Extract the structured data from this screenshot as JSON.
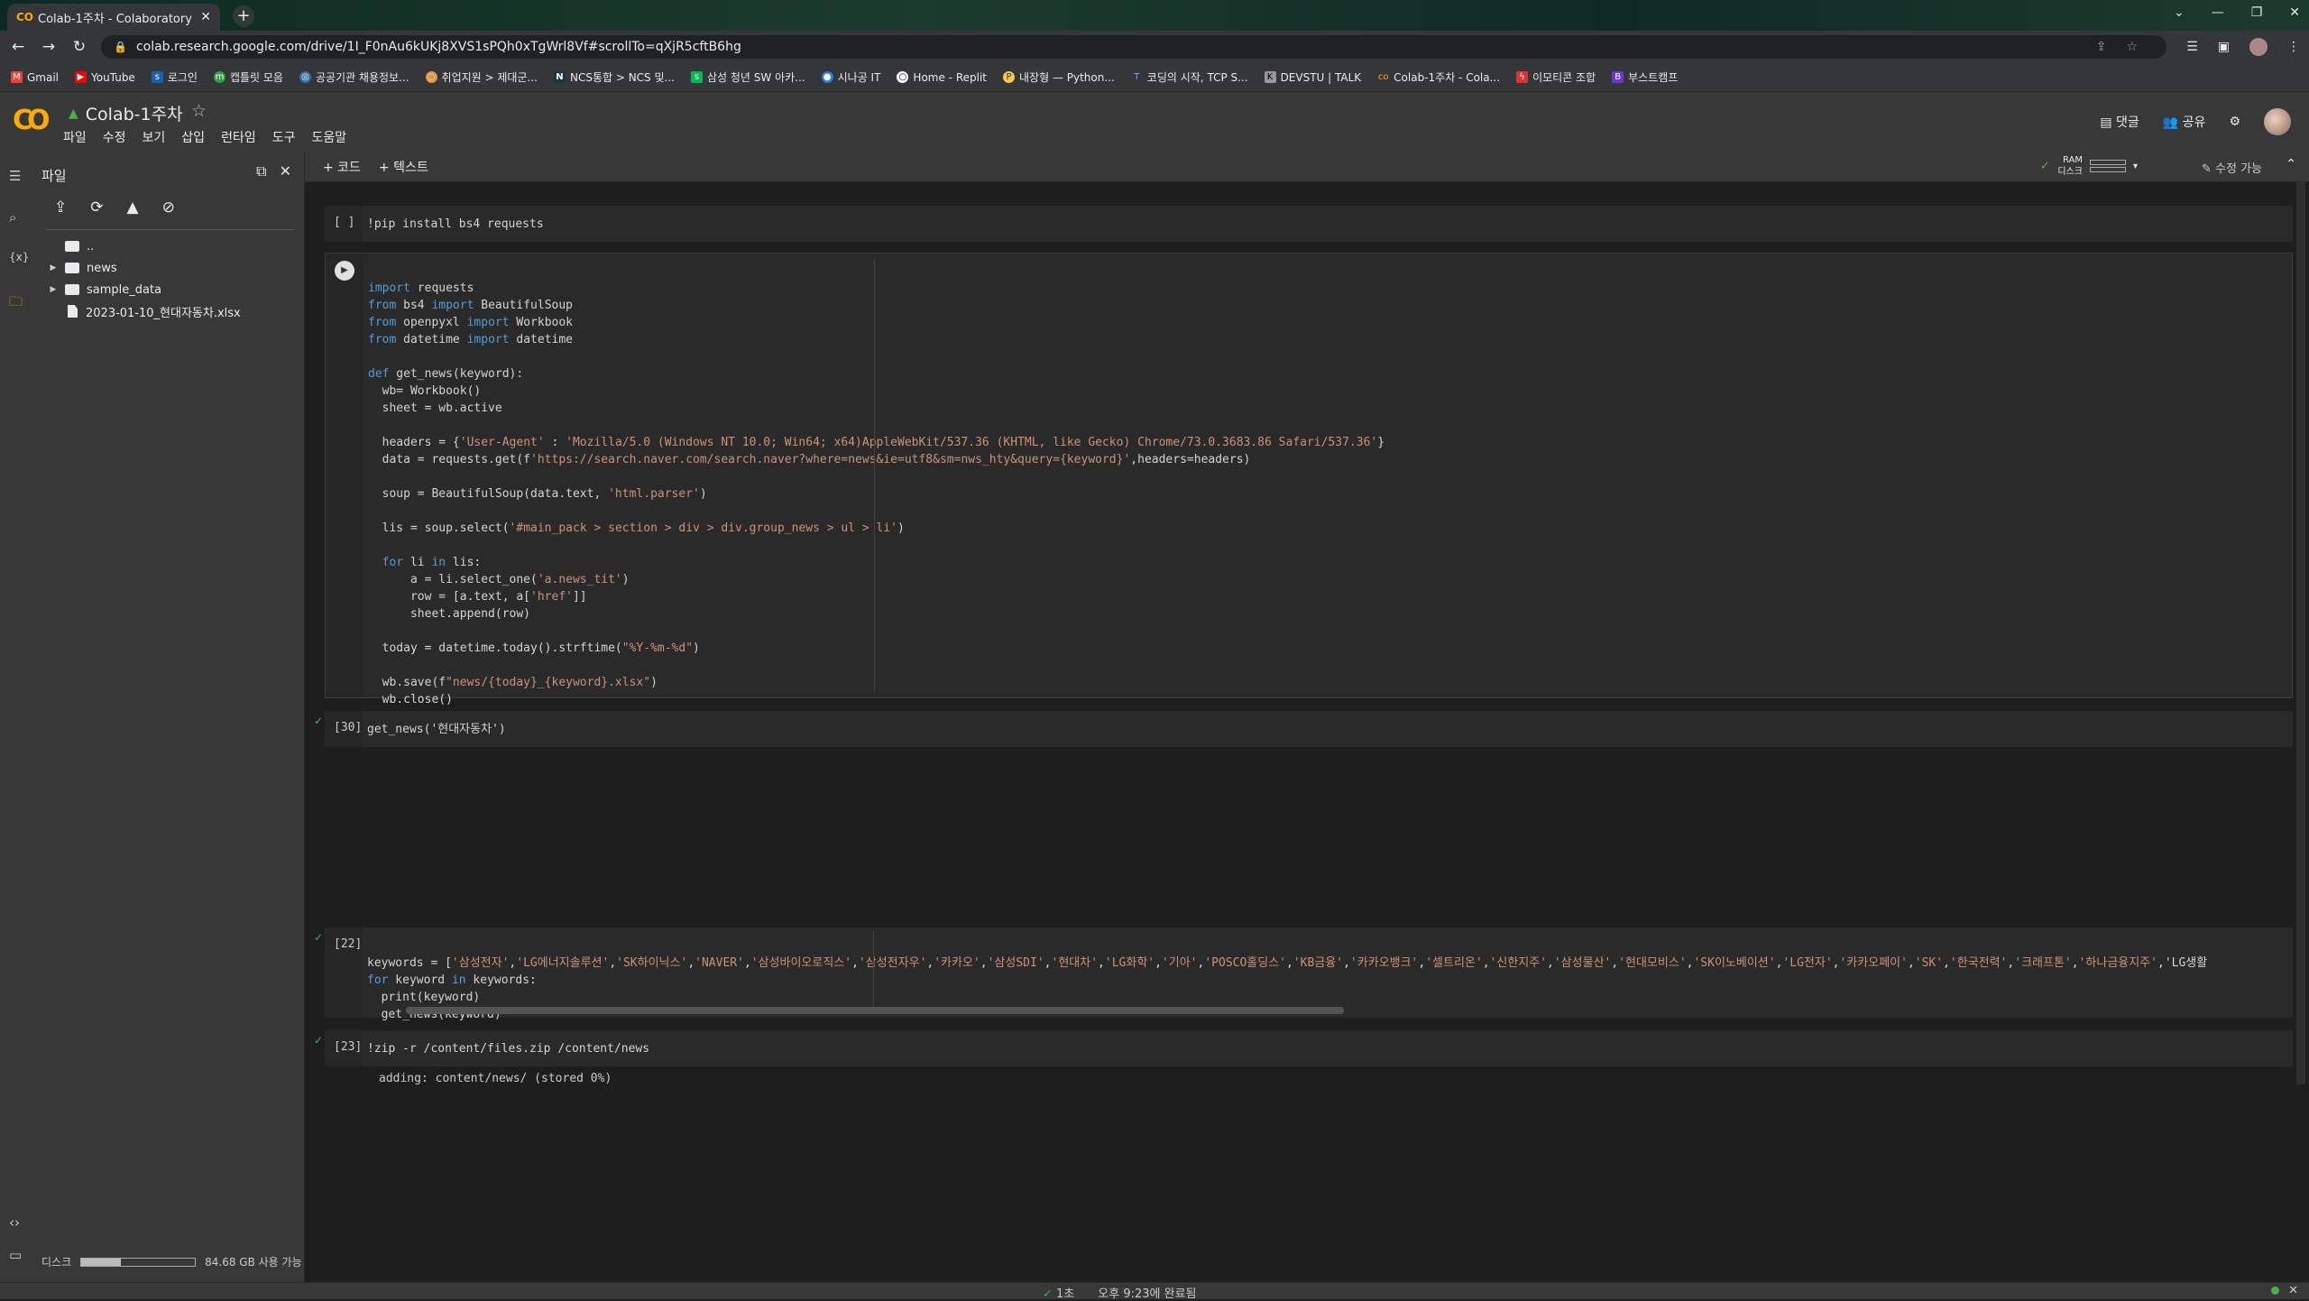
{
  "browser": {
    "tab_title": "Colab-1주차 - Colaboratory",
    "url": "colab.research.google.com/drive/1I_F0nAu6kUKj8XVS1sPQh0xTgWrl8Vf#scrollTo=qXjR5cftB6hg",
    "bookmarks": [
      "Gmail",
      "YouTube",
      "로그인",
      "캡틀릿 모음",
      "공공기관 채용정보...",
      "취업지원 > 제대군...",
      "NCS통합 > NCS 및...",
      "삼성 청년 SW 아카...",
      "시나공 IT",
      "Home - Replit",
      "내장형 — Python...",
      "코딩의 시작, TCP S...",
      "DEVSTU | TALK",
      "Colab-1주차 - Cola...",
      "이모티콘 조합",
      "부스트캠프"
    ]
  },
  "colab": {
    "notebook_title": "Colab-1주차",
    "menu": [
      "파일",
      "수정",
      "보기",
      "삽입",
      "런타임",
      "도구",
      "도움말"
    ],
    "comment_label": "댓글",
    "share_label": "공유",
    "toolbar": {
      "add_code": "+ 코드",
      "add_text": "+ 텍스트",
      "ram_label": "RAM",
      "disk_label": "디스크",
      "edit_mode": "수정 가능"
    }
  },
  "files_panel": {
    "title": "파일",
    "tree": [
      {
        "name": "..",
        "type": "folder"
      },
      {
        "name": "news",
        "type": "folder"
      },
      {
        "name": "sample_data",
        "type": "folder"
      },
      {
        "name": "2023-01-10_현대자동차.xlsx",
        "type": "file"
      }
    ],
    "disk_label": "디스크",
    "disk_usage_text": "84.68 GB 사용 가능",
    "disk_used_fraction": 0.35
  },
  "cells": {
    "cell1": {
      "exec": "[ ]",
      "code": "!pip install bs4 requests"
    },
    "cell2": {
      "lines": [
        "import requests",
        "from bs4 import BeautifulSoup",
        "from openpyxl import Workbook",
        "from datetime import datetime",
        "",
        "def get_news(keyword):",
        "  wb= Workbook()",
        "  sheet = wb.active",
        "",
        "  headers = {'User-Agent' : 'Mozilla/5.0 (Windows NT 10.0; Win64; x64)AppleWebKit/537.36 (KHTML, like Gecko) Chrome/73.0.3683.86 Safari/537.36'}",
        "  data = requests.get(f'https://search.naver.com/search.naver?where=news&ie=utf8&sm=nws_hty&query={keyword}',headers=headers)",
        "",
        "  soup = BeautifulSoup(data.text, 'html.parser')",
        "",
        "  lis = soup.select('#main_pack > section > div > div.group_news > ul > li')",
        "",
        "  for li in lis:",
        "      a = li.select_one('a.news_tit')",
        "      row = [a.text, a['href']]",
        "      sheet.append(row)",
        "",
        "  today = datetime.today().strftime(\"%Y-%m-%d\")",
        "",
        "  wb.save(f\"news/{today}_{keyword}.xlsx\")",
        "  wb.close()"
      ]
    },
    "cell3": {
      "exec": "[30]",
      "code": "get_news('현대자동차')"
    },
    "cell4": {
      "exec": "[22]",
      "lines": [
        "keywords = ['삼성전자','LG에너지솔루션','SK하이닉스','NAVER','삼성바이오로직스','삼성전자우','카카오','삼성SDI','현대차','LG화학','기아','POSCO홀딩스','KB금융','카카오뱅크','셀트리온','신한지주','삼성물산','현대모비스','SK이노베이션','LG전자','카카오페이','SK','한국전력','크래프톤','하나금융지주','LG생활",
        "for keyword in keywords:",
        "  print(keyword)",
        "  get_news(keyword)"
      ]
    },
    "cell5": {
      "exec": "[23]",
      "code": "!zip -r /content/files.zip /content/news",
      "output": "adding: content/news/ (stored 0%)"
    }
  },
  "status": {
    "duration": "1초",
    "completed": "오후 9:23에 완료됨"
  }
}
